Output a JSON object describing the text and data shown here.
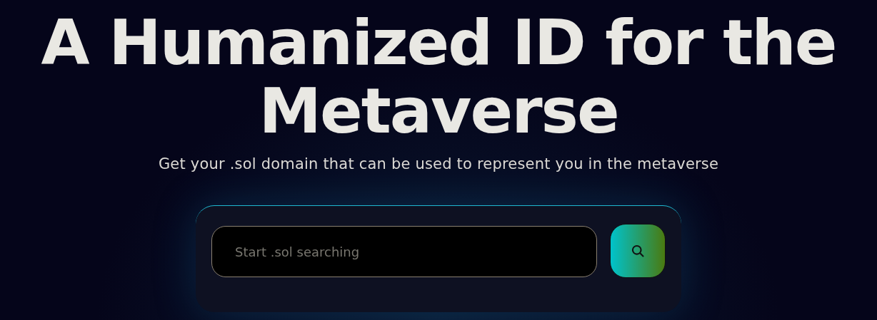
{
  "hero": {
    "headline": "A Humanized ID for the Metaverse",
    "subtitle": "Get your .sol domain that can be used to represent you in the metaverse"
  },
  "search": {
    "placeholder": "Start .sol searching"
  }
}
